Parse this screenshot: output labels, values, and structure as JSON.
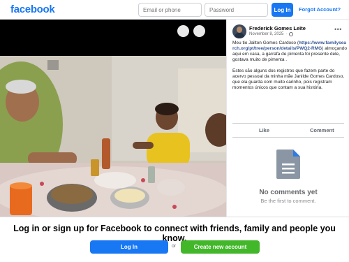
{
  "header": {
    "logo": "facebook",
    "email_placeholder": "Email or phone",
    "password_placeholder": "Password",
    "login_label": "Log In",
    "forgot_label": "Forgot Account?"
  },
  "photo": {
    "alt_description": "Family meal photo"
  },
  "post": {
    "author": "Frederick Gomes Leite",
    "date": "November 8, 2025",
    "text_intro": "Meu tio Jailton Gomes Cardoso (",
    "link": "https://www.familysearch.org/pt/tree/person/details/PWQ2-RMG",
    "text_after_link": ") almoçando aqui em casa, a garrafa de pimenta foi presente dele, gostava muito de pimenta .",
    "text_second": "Estes são alguns dos registros que fazem parte do acervo pessoal da minha mãe Janilde Gomes Cardoso, que ela guarda com muito carinho, pois registram momentos únicos que contam a sua história.",
    "like_label": "Like",
    "comment_label": "Comment",
    "no_comments_title": "No comments yet",
    "no_comments_sub": "Be the first to comment."
  },
  "bottom": {
    "cta": "Log in or sign up for Facebook to connect with friends, family and people you know.",
    "login_label": "Log In",
    "or_label": "or",
    "create_label": "Create new account"
  },
  "colors": {
    "brand": "#1877f2",
    "create_green": "#42b72a"
  }
}
